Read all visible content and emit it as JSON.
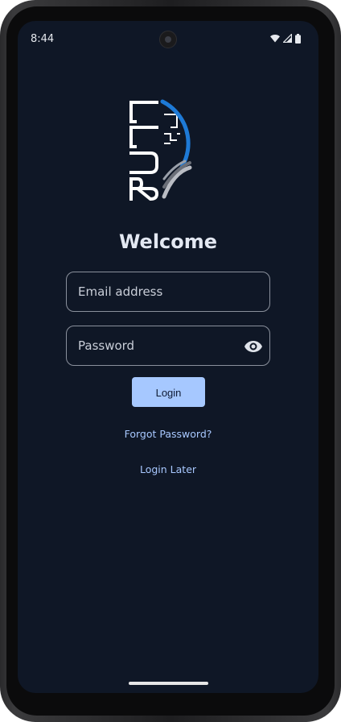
{
  "status_bar": {
    "time": "8:44",
    "icons": [
      "wifi-icon",
      "cellular-icon",
      "battery-icon"
    ]
  },
  "logo": {
    "text": "BUCC",
    "accent_color": "#1e7ad6"
  },
  "login_form": {
    "title": "Welcome",
    "email": {
      "value": "",
      "placeholder": "Email address"
    },
    "password": {
      "value": "",
      "placeholder": "Password",
      "toggle_icon": "eye-icon"
    },
    "login_label": "Login",
    "forgot_password_label": "Forgot Password?",
    "login_later_label": "Login Later"
  },
  "colors": {
    "background": "#0f1726",
    "primary_button": "#a6c8ff",
    "link": "#a8c8ff"
  }
}
